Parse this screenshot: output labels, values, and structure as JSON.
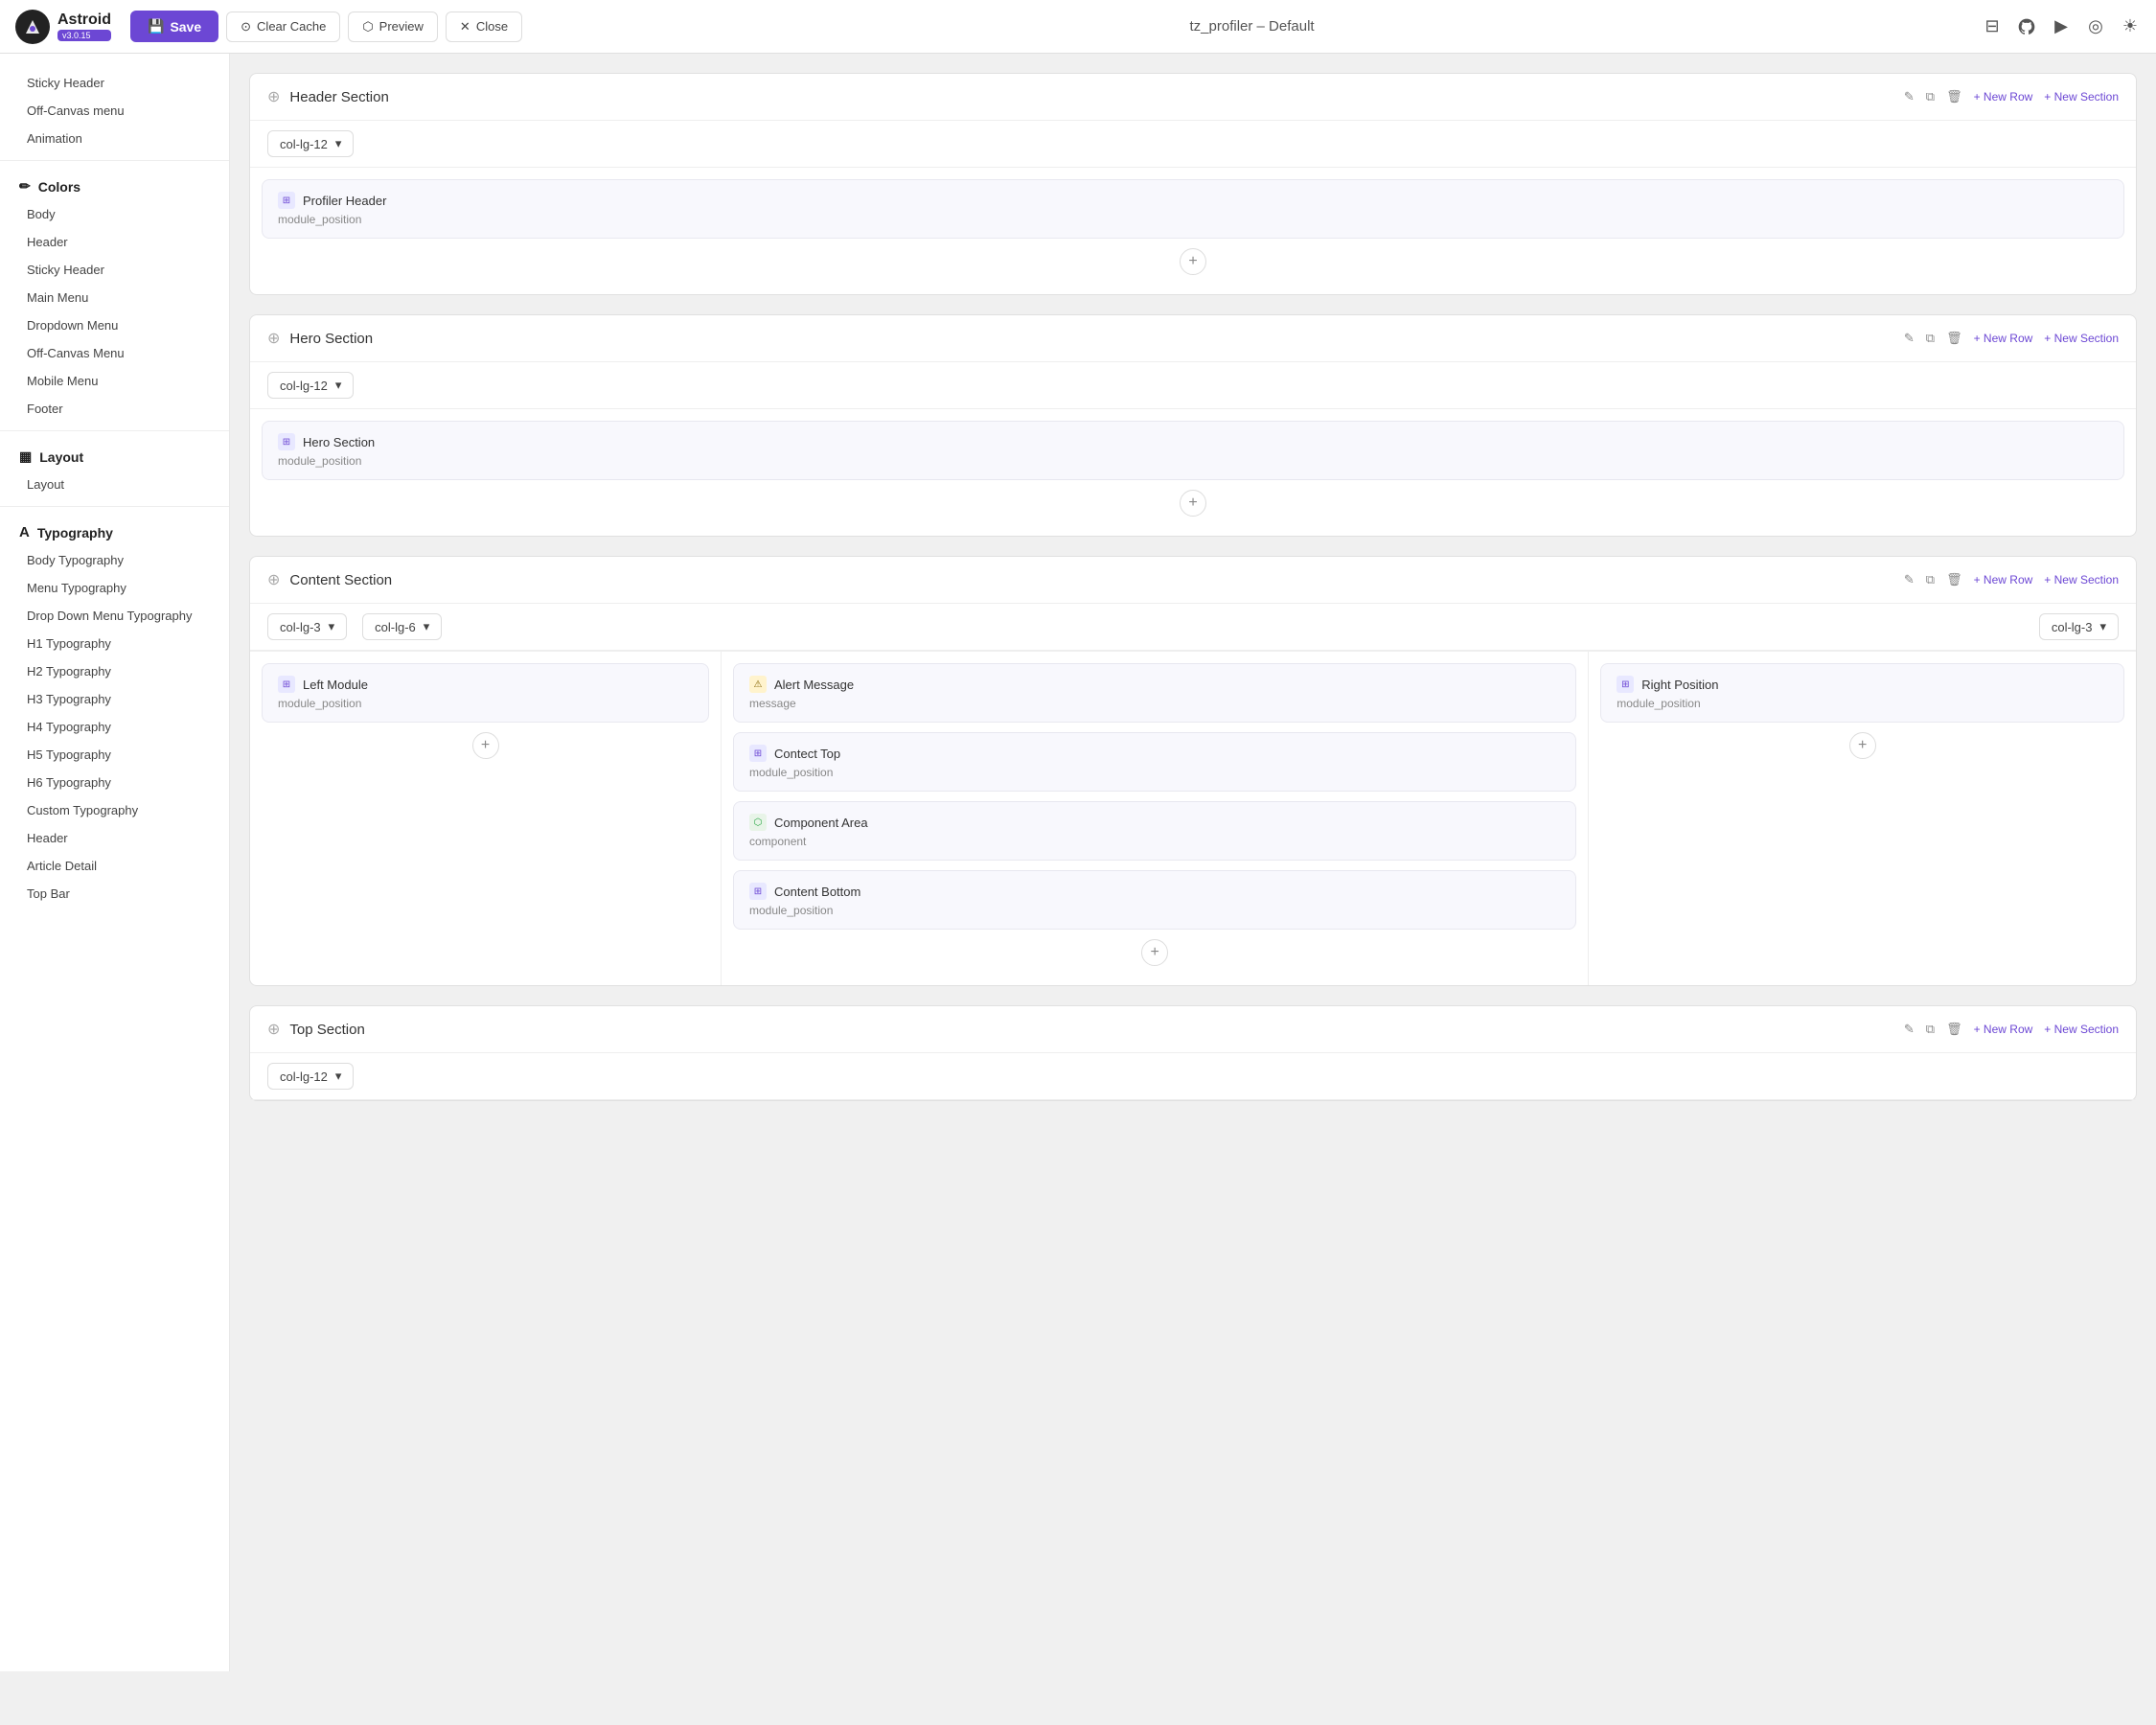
{
  "topbar": {
    "logo_text": "Astroid",
    "version": "v3.0.15",
    "save_label": "Save",
    "clear_cache_label": "Clear Cache",
    "preview_label": "Preview",
    "close_label": "Close",
    "page_title": "tz_profiler – Default"
  },
  "sidebar": {
    "sections": [
      {
        "id": "colors",
        "icon": "✏",
        "label": "Colors",
        "items": [
          "Body",
          "Header",
          "Sticky Header",
          "Main Menu",
          "Dropdown Menu",
          "Off-Canvas Menu",
          "Mobile Menu",
          "Footer"
        ]
      },
      {
        "id": "layout",
        "icon": "▦",
        "label": "Layout",
        "items": [
          "Layout"
        ]
      },
      {
        "id": "typography",
        "icon": "A",
        "label": "Typography",
        "items": [
          "Body Typography",
          "Menu Typography",
          "Drop Down Menu Typography",
          "H1 Typography",
          "H2 Typography",
          "H3 Typography",
          "H4 Typography",
          "H5 Typography",
          "H6 Typography",
          "Custom Typography",
          "Header",
          "Article Detail",
          "Top Bar"
        ]
      }
    ],
    "above_items": [
      "Sticky Header",
      "Off-Canvas menu",
      "Animation"
    ]
  },
  "content": {
    "sections": [
      {
        "id": "header-section",
        "title": "Header Section",
        "col_options": [
          "col-lg-12"
        ],
        "selected_col": "col-lg-12",
        "rows": [
          {
            "cols": [
              {
                "span": 12,
                "modules": [
                  {
                    "id": "profiler-header",
                    "icon": "⊞",
                    "title": "Profiler Header",
                    "sub": "module_position",
                    "icon_type": "default"
                  }
                ]
              }
            ]
          }
        ]
      },
      {
        "id": "hero-section",
        "title": "Hero Section",
        "col_options": [
          "col-lg-12"
        ],
        "selected_col": "col-lg-12",
        "rows": [
          {
            "cols": [
              {
                "span": 12,
                "modules": [
                  {
                    "id": "hero-section",
                    "icon": "⊞",
                    "title": "Hero Section",
                    "sub": "module_position",
                    "icon_type": "default"
                  }
                ]
              }
            ]
          }
        ]
      },
      {
        "id": "content-section",
        "title": "Content Section",
        "col_options": [
          "col-lg-3",
          "col-lg-6",
          "col-lg-3"
        ],
        "rows": [
          {
            "cols": [
              {
                "span": 3,
                "col_label": "col-lg-3",
                "modules": [
                  {
                    "id": "left-module",
                    "icon": "⊞",
                    "title": "Left Module",
                    "sub": "module_position",
                    "icon_type": "default"
                  }
                ]
              },
              {
                "span": 6,
                "col_label": "col-lg-6",
                "modules": [
                  {
                    "id": "alert-message",
                    "icon": "⚠",
                    "title": "Alert Message",
                    "sub": "message",
                    "icon_type": "warning"
                  },
                  {
                    "id": "contect-top",
                    "icon": "⊞",
                    "title": "Contect Top",
                    "sub": "module_position",
                    "icon_type": "default"
                  },
                  {
                    "id": "component-area",
                    "icon": "⬡",
                    "title": "Component Area",
                    "sub": "component",
                    "icon_type": "puzzle"
                  },
                  {
                    "id": "content-bottom",
                    "icon": "⊞",
                    "title": "Content Bottom",
                    "sub": "module_position",
                    "icon_type": "default"
                  }
                ]
              },
              {
                "span": 3,
                "col_label": "col-lg-3",
                "modules": [
                  {
                    "id": "right-position",
                    "icon": "⊞",
                    "title": "Right Position",
                    "sub": "module_position",
                    "icon_type": "default"
                  }
                ]
              }
            ]
          }
        ]
      },
      {
        "id": "top-section",
        "title": "Top Section",
        "col_options": [
          "col-lg-12"
        ],
        "selected_col": "col-lg-12",
        "rows": []
      }
    ]
  },
  "labels": {
    "new_row": "+ New Row",
    "new_section": "+ New Section",
    "add_icon": "+",
    "chevron_down": "▾"
  }
}
